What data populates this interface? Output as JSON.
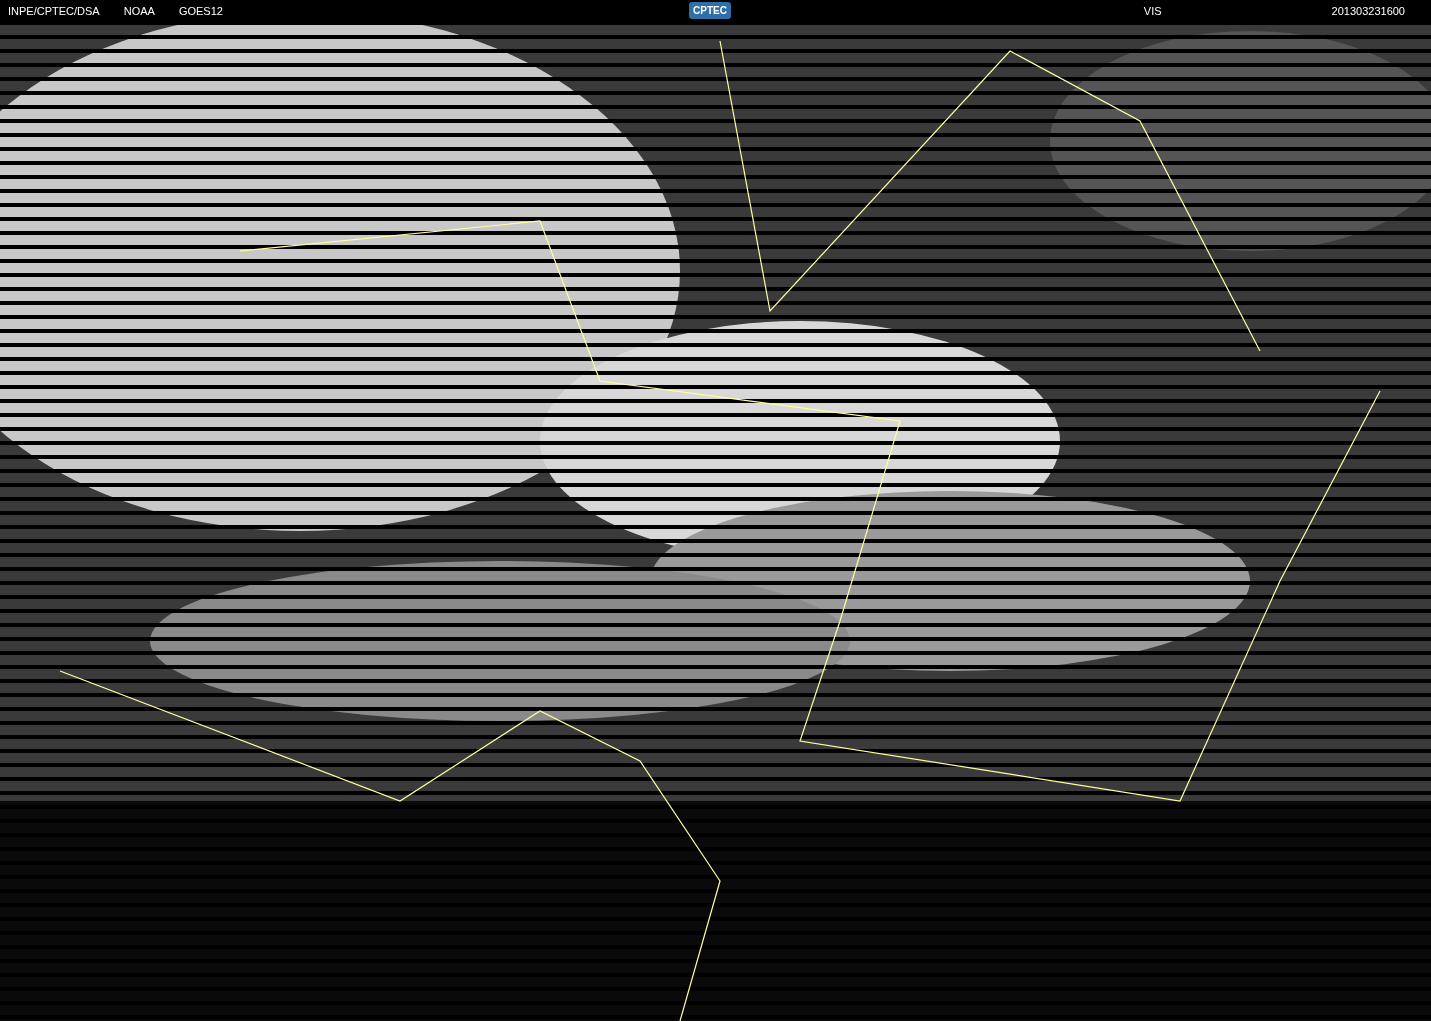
{
  "header": {
    "left": [
      "INPE/CPTEC/DSA",
      "NOAA",
      "GOES12"
    ],
    "logo": "CPTEC",
    "channel": "VIS",
    "timestamp": "201303231600"
  }
}
